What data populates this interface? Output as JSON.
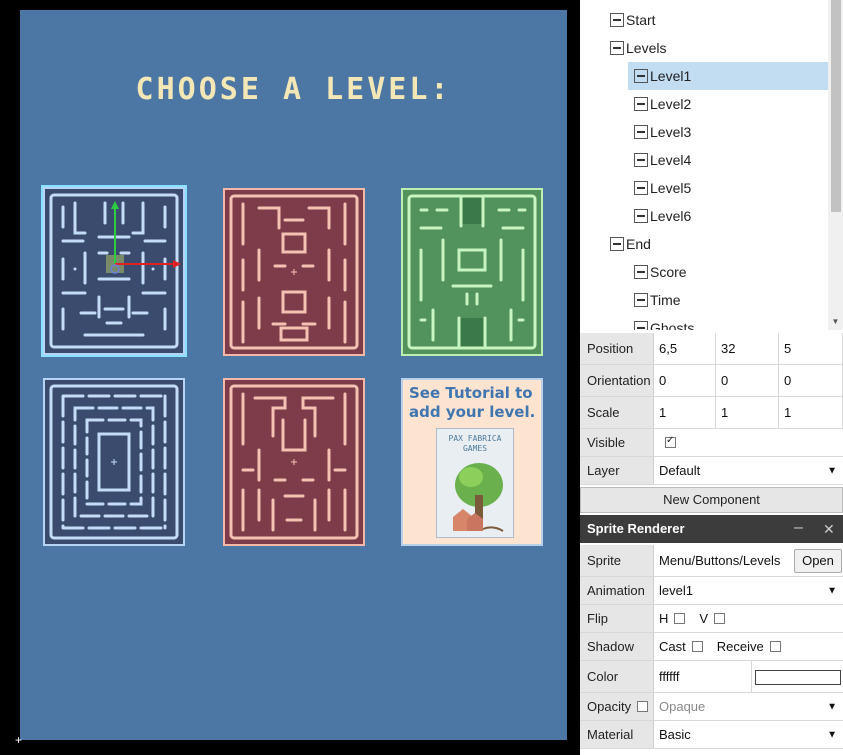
{
  "game": {
    "title": "CHOOSE A LEVEL:",
    "tutorial_text": "See Tutorial to add your level.",
    "book_title": "PAX FABRICA GAMES"
  },
  "hierarchy": [
    {
      "label": "Start",
      "indent": 0,
      "selected": false
    },
    {
      "label": "Levels",
      "indent": 0,
      "selected": false
    },
    {
      "label": "Level1",
      "indent": 1,
      "selected": true
    },
    {
      "label": "Level2",
      "indent": 1,
      "selected": false
    },
    {
      "label": "Level3",
      "indent": 1,
      "selected": false
    },
    {
      "label": "Level4",
      "indent": 1,
      "selected": false
    },
    {
      "label": "Level5",
      "indent": 1,
      "selected": false
    },
    {
      "label": "Level6",
      "indent": 1,
      "selected": false
    },
    {
      "label": "End",
      "indent": 0,
      "selected": false
    },
    {
      "label": "Score",
      "indent": 1,
      "selected": false
    },
    {
      "label": "Time",
      "indent": 1,
      "selected": false
    },
    {
      "label": "Ghosts",
      "indent": 1,
      "selected": false
    }
  ],
  "transform": {
    "position_label": "Position",
    "position": [
      "6,5",
      "32",
      "5"
    ],
    "orientation_label": "Orientation",
    "orientation": [
      "0",
      "0",
      "0"
    ],
    "scale_label": "Scale",
    "scale": [
      "1",
      "1",
      "1"
    ],
    "visible_label": "Visible",
    "visible": true,
    "layer_label": "Layer",
    "layer": "Default"
  },
  "new_component_label": "New Component",
  "sprite_renderer": {
    "header": "Sprite Renderer",
    "sprite_label": "Sprite",
    "sprite": "Menu/Buttons/Levels",
    "open_label": "Open",
    "animation_label": "Animation",
    "animation": "level1",
    "flip_label": "Flip",
    "flip_h": "H",
    "flip_v": "V",
    "shadow_label": "Shadow",
    "cast_label": "Cast",
    "receive_label": "Receive",
    "color_label": "Color",
    "color": "ffffff",
    "opacity_label": "Opacity",
    "opacity": "Opaque",
    "material_label": "Material",
    "material": "Basic"
  },
  "colors": {
    "game_bg": "#4c77a5",
    "title": "#f4e7b6",
    "selection": "#c2dcf2",
    "gizmo_y": "#2ecc40",
    "gizmo_x": "#e02020"
  }
}
